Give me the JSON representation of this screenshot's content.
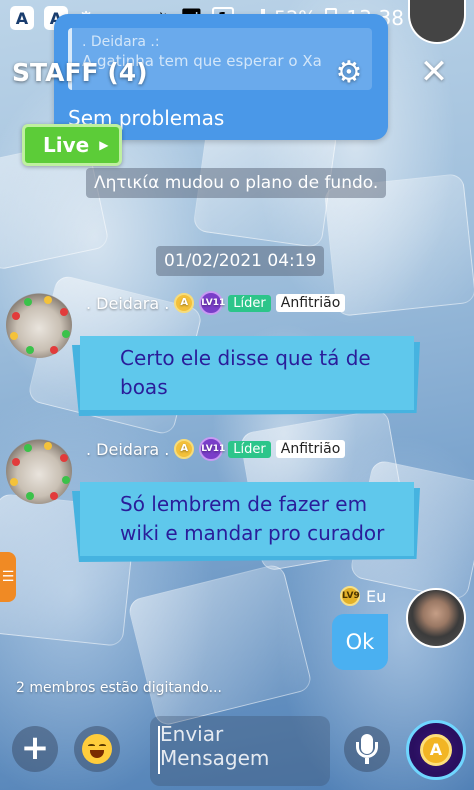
{
  "status_bar": {
    "app_icon_1": "A",
    "app_icon_2": "A",
    "sim_slot": "1",
    "battery_percent": "52%",
    "time": "13:38"
  },
  "header": {
    "title": "STAFF (4)",
    "reply_preview": {
      "quoted_author": ". Deidara .:",
      "quoted_text": "A gatinha tem que esperar o Xa",
      "reply_text": "Sem problemas"
    }
  },
  "live_badge": {
    "label": "Live"
  },
  "system_message": "Λητικία mudou o plano de fundo.",
  "date_separator": "01/02/2021 04:19",
  "messages": [
    {
      "author": ". Deidara .",
      "level": "LV11",
      "coin_badge": "A",
      "role_tag": "Líder",
      "host_tag": "Anfitrião",
      "text_line1": "Certo ele disse que tá de",
      "text_line2": "boas"
    },
    {
      "author": ". Deidara .",
      "level": "LV11",
      "coin_badge": "A",
      "role_tag": "Líder",
      "host_tag": "Anfitrião",
      "text_line1": "Só lembrem de fazer em",
      "text_line2": "wiki e mandar pro curador"
    }
  ],
  "my_message": {
    "author": "Eu",
    "level": "LV9",
    "text": "Ok"
  },
  "typing_indicator": "2 membros estão digitando...",
  "composer": {
    "placeholder_line1": "Enviar",
    "placeholder_line2": "Mensagem",
    "coin_label": "A"
  },
  "colors": {
    "bubble_bg": "#5fc8ec",
    "bubble_text": "#2a1d9a",
    "my_bubble_bg": "#4ab0f1",
    "leader_tag": "#2cc58a",
    "live_badge": "#5ccc38"
  }
}
